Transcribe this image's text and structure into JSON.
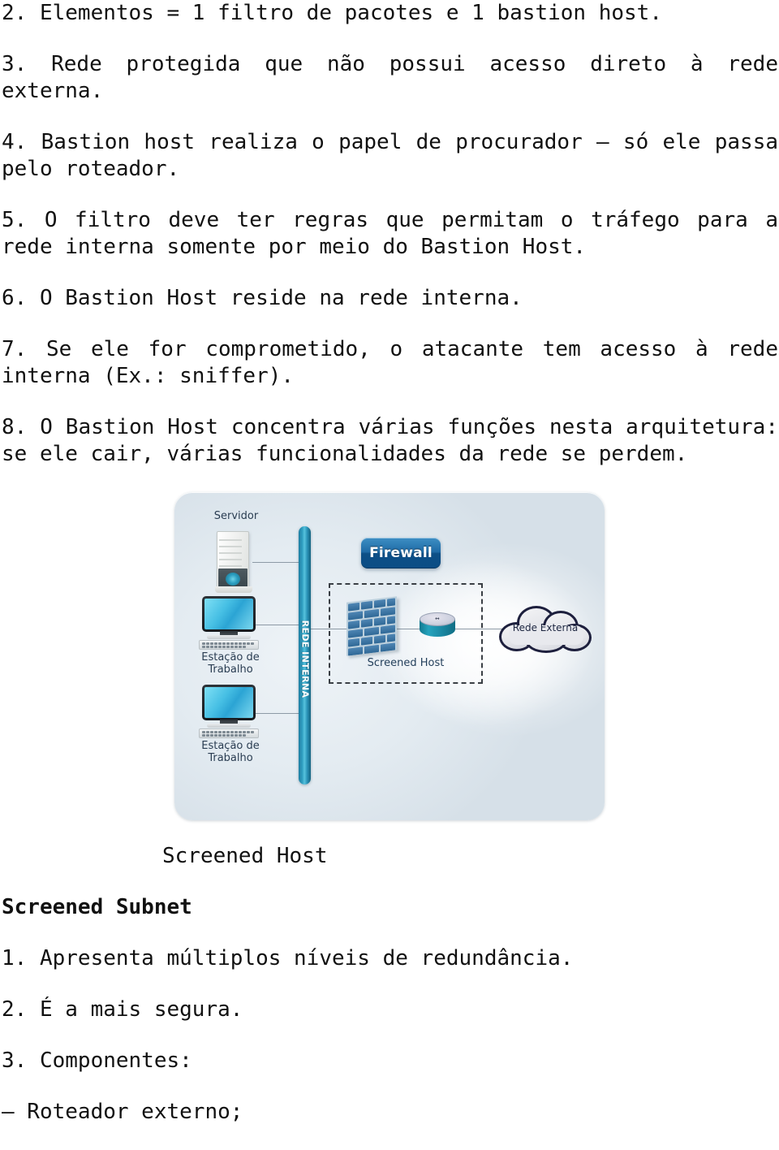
{
  "document": {
    "paragraphs": [
      "2. Elementos = 1 filtro de pacotes e 1 bastion host.",
      "3. Rede protegida que não possui acesso direto à rede externa.",
      "4. Bastion host realiza o papel de procurador — só ele passa pelo roteador.",
      "5. O filtro deve ter regras que permitam o tráfego para a rede interna somente por meio do Bastion Host.",
      "6. O Bastion Host reside na rede interna.",
      "7. Se ele for comprometido, o atacante tem acesso à rede interna (Ex.: sniffer).",
      "8. O Bastion Host concentra várias funções nesta arquitetura: se ele cair, várias funcionalidades da rede se perdem."
    ],
    "figure_caption": "Screened Host",
    "section_heading": "Screened Subnet",
    "section_items": [
      "1. Apresenta múltiplos níveis de redundância.",
      "2. É a mais segura.",
      "3. Componentes:",
      "— Roteador externo;"
    ]
  },
  "figure": {
    "alt_name": "screened-host-network-diagram",
    "firewall_badge": "Firewall",
    "internal_network_label": "REDE INTERNA",
    "screened_host_label": "Screened Host",
    "external_network_label": "Rede Externa",
    "server_label": "Servidor",
    "workstation_label_line1": "Estação de",
    "workstation_label_line2": "Trabalho",
    "router_arrow_glyph": "↔",
    "colors": {
      "panel_background": "#e3ebf1",
      "firewall_badge": "#0d4f86",
      "backbone_teal": "#2f9ec0",
      "brick_blue": "#2f6896",
      "cloud_outline": "#1d1f3d",
      "cloud_fill": "#e8e9ee",
      "wire": "#8d9aa6",
      "dashed_border": "#3a3f45",
      "screen_cyan": "#46bfe4"
    }
  }
}
